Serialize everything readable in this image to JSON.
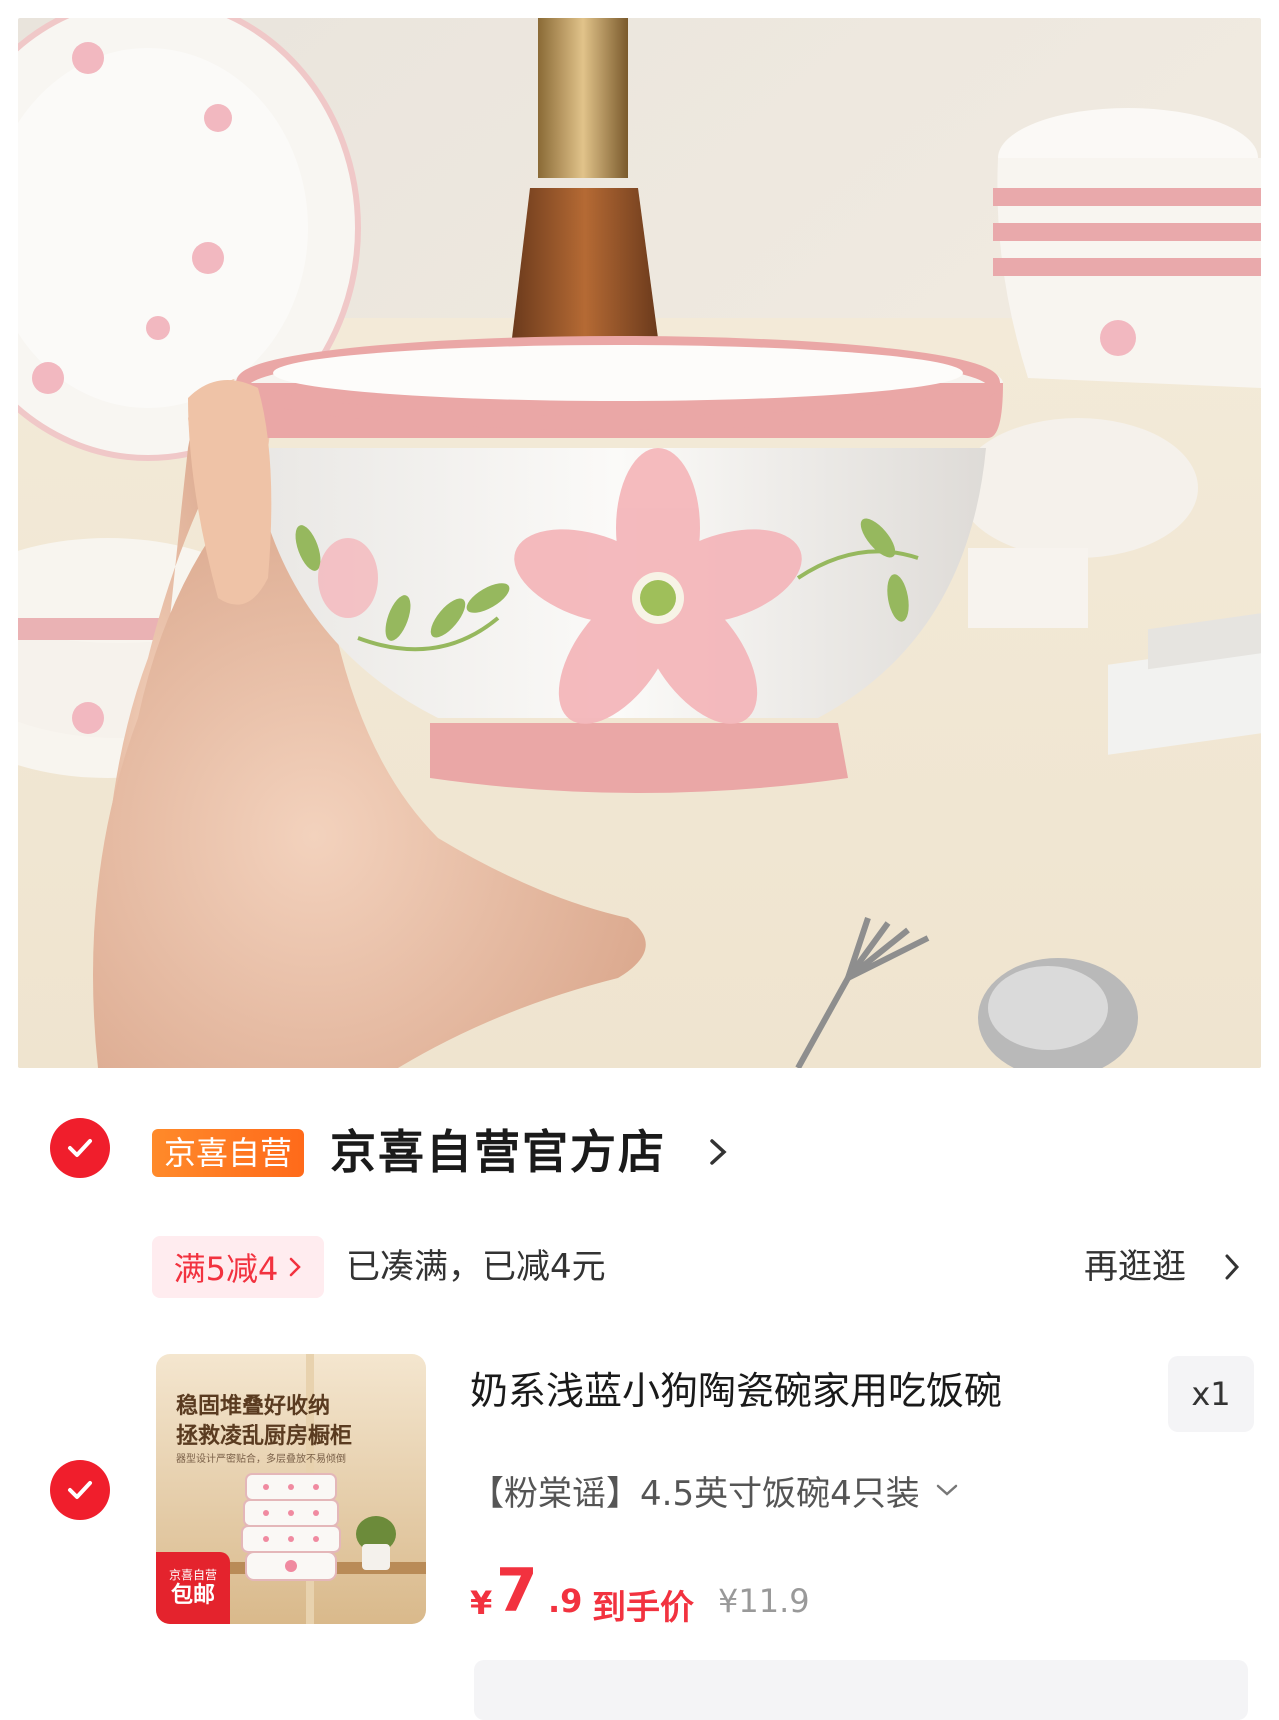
{
  "hero": {
    "alt": ""
  },
  "shop": {
    "badge": "京喜自营",
    "name": "京喜自营官方店"
  },
  "promo": {
    "tag": "满5减4",
    "message": "已凑满，已减4元",
    "browse": "再逛逛"
  },
  "product": {
    "thumb_line1": "稳固堆叠好收纳",
    "thumb_line2": "拯救凌乱厨房橱柜",
    "thumb_line3": "器型设计严密贴合，多层叠放不易倾倒",
    "thumb_corner_top": "京喜自营",
    "thumb_corner_bottom": "包邮",
    "title": "奶系浅蓝小狗陶瓷碗家用吃饭碗",
    "quantity": "x1",
    "spec": "【粉棠谣】4.5英寸饭碗4只装",
    "price_currency": "¥",
    "price_int": "7",
    "price_dec": ".9",
    "price_label": "到手价",
    "original_price": "¥11.9"
  },
  "colors": {
    "accent_red": "#f01e2c",
    "badge_orange": "#ff7a22",
    "promo_bg": "#ffecef"
  }
}
